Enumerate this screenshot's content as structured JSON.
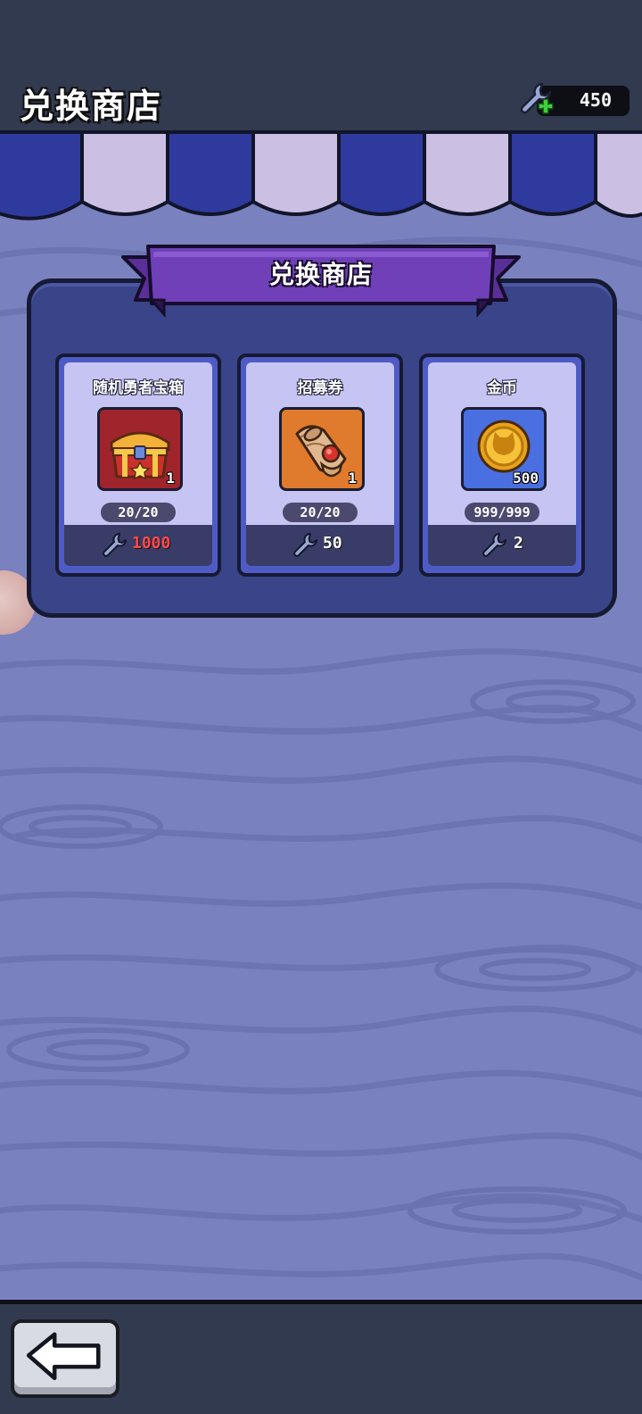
{
  "header": {
    "title": "兑换商店",
    "currency": {
      "icon": "wrench-plus-icon",
      "value": "450"
    }
  },
  "shop": {
    "banner_title": "兑换商店",
    "items": [
      {
        "name": "随机勇者宝箱",
        "icon": "treasure-chest-icon",
        "quantity": "1",
        "stock": "20/20",
        "price_icon": "wrench-icon",
        "price": "1000",
        "price_color": "#ff4a4a",
        "bg_color": "#a0242c"
      },
      {
        "name": "招募券",
        "icon": "scroll-ticket-icon",
        "quantity": "1",
        "stock": "20/20",
        "price_icon": "wrench-icon",
        "price": "50",
        "price_color": "#ffffff",
        "bg_color": "#e07a2c"
      },
      {
        "name": "金币",
        "icon": "gold-coin-icon",
        "quantity": "500",
        "stock": "999/999",
        "price_icon": "wrench-icon",
        "price": "2",
        "price_color": "#ffffff",
        "bg_color": "#4a6fe0"
      }
    ]
  },
  "footer": {
    "back_icon": "back-arrow-icon"
  },
  "colors": {
    "background": "#7a81bf",
    "panel": "#3a4488",
    "banner": "#6d3bb0",
    "awning_blue": "#2f3a9e",
    "awning_light": "#cbc0e3"
  }
}
